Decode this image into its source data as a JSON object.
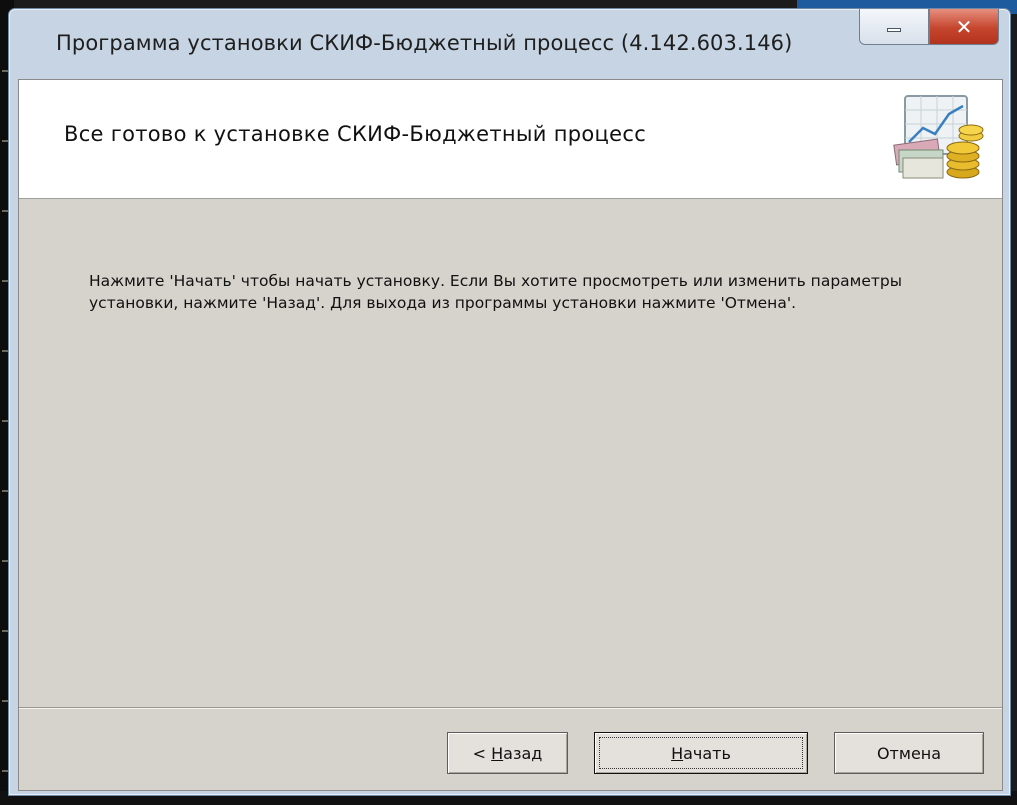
{
  "window": {
    "title": "Программа установки СКИФ-Бюджетный процесс (4.142.603.146)",
    "minimize_glyph": "–",
    "close_glyph": "✕"
  },
  "header": {
    "title": "Все готово к установке СКИФ-Бюджетный процесс",
    "icon": "chart-coins-icon"
  },
  "body": {
    "message": "Нажмите 'Начать' чтобы начать установку. Если Вы хотите просмотреть или изменить параметры установки, нажмите 'Назад'. Для выхода из программы установки нажмите 'Отмена'."
  },
  "buttons": {
    "back_prefix": "< ",
    "back_mnemonic": "Н",
    "back_rest": "азад",
    "start_mnemonic": "Н",
    "start_rest": "ачать",
    "cancel": "Отмена"
  },
  "colors": {
    "close_button": "#c6452e",
    "dialog_background": "#d6d2cc",
    "header_background": "#ffffff"
  }
}
